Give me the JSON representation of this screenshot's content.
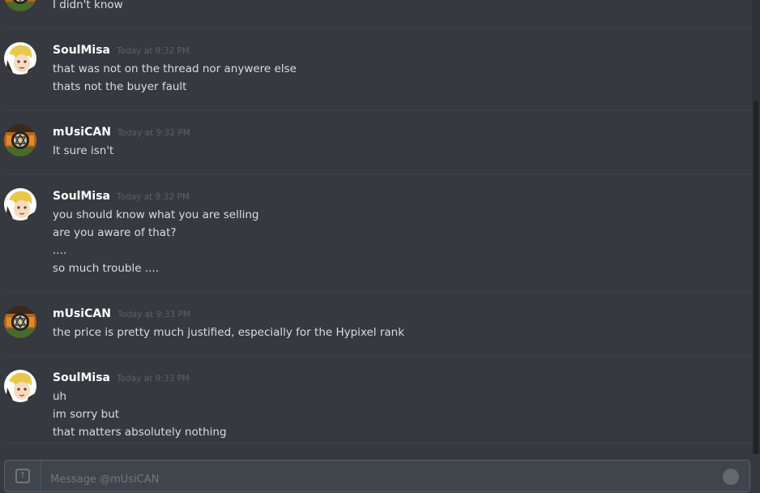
{
  "messages": [
    {
      "author": "",
      "timestamp": "",
      "avatar": "musican-avatar",
      "lines": [
        "I didn't know"
      ]
    },
    {
      "author": "SoulMisa",
      "timestamp": "Today at 9:32 PM",
      "avatar": "soulmisa-avatar",
      "lines": [
        "that was not on the thread nor anywere else",
        "thats not the buyer fault"
      ]
    },
    {
      "author": "mUsiCAN",
      "timestamp": "Today at 9:32 PM",
      "avatar": "musican-avatar",
      "lines": [
        "It sure isn't"
      ]
    },
    {
      "author": "SoulMisa",
      "timestamp": "Today at 9:32 PM",
      "avatar": "soulmisa-avatar",
      "lines": [
        "you should know what you are selling",
        "are you aware of that?",
        "....",
        "so much trouble ...."
      ]
    },
    {
      "author": "mUsiCAN",
      "timestamp": "Today at 9:33 PM",
      "avatar": "musican-avatar",
      "lines": [
        "the price is pretty much justified, especially for the Hypixel rank"
      ]
    },
    {
      "author": "SoulMisa",
      "timestamp": "Today at 9:33 PM",
      "avatar": "soulmisa-avatar",
      "lines": [
        "uh",
        "im sorry but",
        "that matters absolutely nothing"
      ]
    }
  ],
  "composer": {
    "placeholder": "Message @mUsiCAN",
    "upload_icon": "upload-icon",
    "emoji_icon": "emoji-icon"
  },
  "colors": {
    "background": "#36393f",
    "text": "#dcddde",
    "username": "#ffffff",
    "timestamp": "#5c6067"
  }
}
